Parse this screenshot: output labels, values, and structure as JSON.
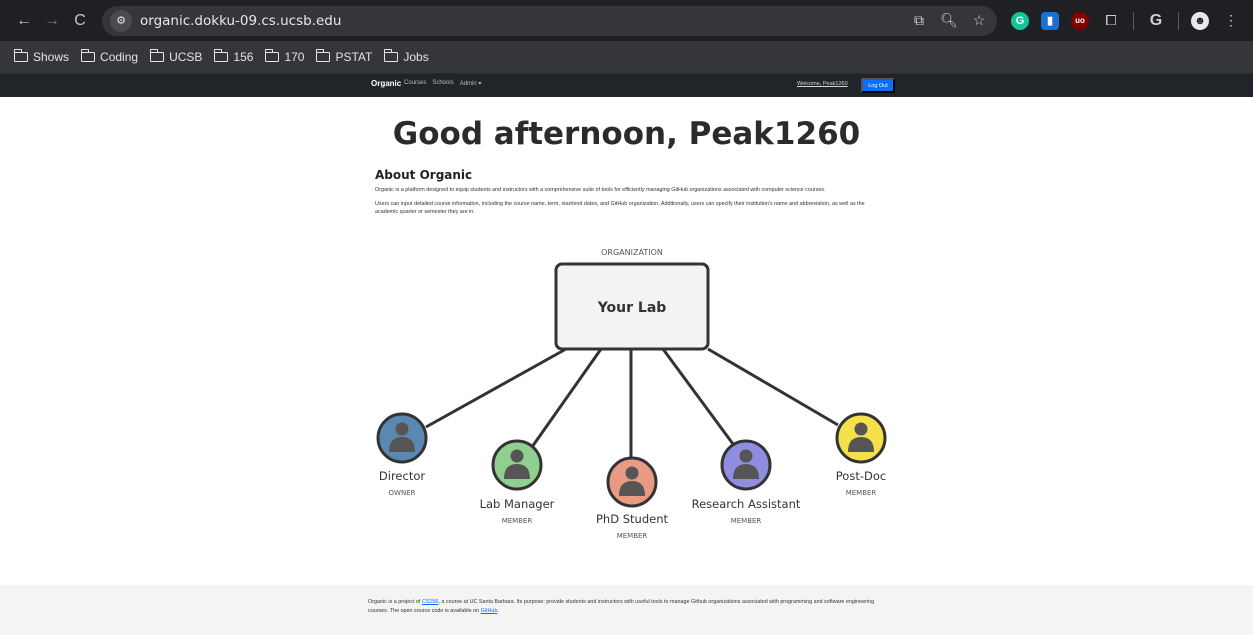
{
  "browser": {
    "url": "organic.dokku-09.cs.ucsb.edu",
    "bookmarks": [
      "Shows",
      "Coding",
      "UCSB",
      "156",
      "170",
      "PSTAT",
      "Jobs"
    ]
  },
  "navbar": {
    "brand": "Organic",
    "links": [
      "Courses",
      "Schools",
      "Admin ▾"
    ],
    "welcome": "Welcome, Peak1260",
    "logout": "Log Out"
  },
  "main": {
    "greeting": "Good afternoon, Peak1260",
    "about_title": "About Organic",
    "about_p1": "Organic is a platform designed to equip students and instructors with a comprehensive suite of tools for efficiently managing GitHub organizations associated with computer science courses.",
    "about_p2": "Users can input detailed course information, including the course name, term, start/end dates, and GitHub organization. Additionally, users can specify their institution's name and abbreviation, as well as the academic quarter or semester they are in."
  },
  "diagram": {
    "org_label": "ORGANIZATION",
    "org_name": "Your Lab",
    "roles": [
      {
        "name": "Director",
        "type": "OWNER",
        "color": "#5b88b0"
      },
      {
        "name": "Lab Manager",
        "type": "MEMBER",
        "color": "#8fcf8f"
      },
      {
        "name": "PhD Student",
        "type": "MEMBER",
        "color": "#e99a82"
      },
      {
        "name": "Research Assistant",
        "type": "MEMBER",
        "color": "#8e8de0"
      },
      {
        "name": "Post-Doc",
        "type": "MEMBER",
        "color": "#f5e04a"
      }
    ]
  },
  "footer": {
    "text_1": "Organic is a project of ",
    "link_course": "CS156",
    "text_2": ", a course at UC Santa Barbara. Its purpose: provide students and instructors with useful tools to manage Github organizations associated with programming and software engineering courses. The open source code is available on ",
    "link_github": "GitHub",
    "text_3": "."
  }
}
